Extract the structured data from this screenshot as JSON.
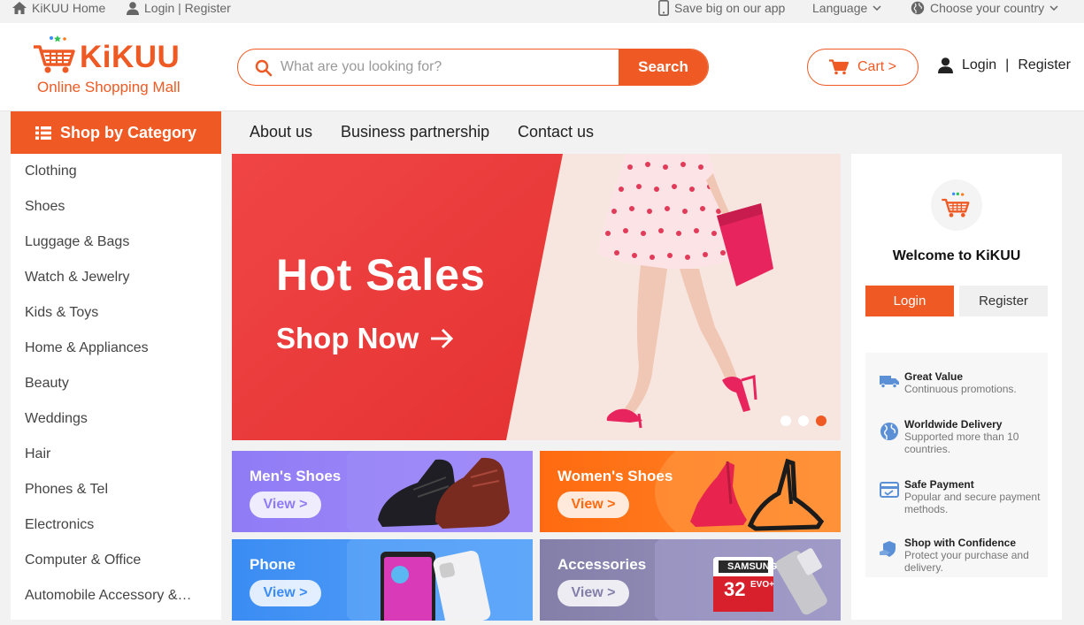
{
  "topbar": {
    "home_label": "KiKUU Home",
    "login_register": "Login | Register",
    "app_promo": "Save big on our app",
    "language": "Language",
    "country": "Choose your country"
  },
  "header": {
    "logo_name": "KiKUU",
    "logo_tagline": "Online Shopping Mall",
    "search_placeholder": "What are you looking for?",
    "search_button": "Search",
    "cart_label": "Cart >",
    "login_label": "Login",
    "separator": "|",
    "register_label": "Register"
  },
  "sidebar": {
    "title": "Shop by Category",
    "items": [
      {
        "label": "Clothing"
      },
      {
        "label": "Shoes"
      },
      {
        "label": "Luggage & Bags"
      },
      {
        "label": "Watch & Jewelry"
      },
      {
        "label": "Kids & Toys"
      },
      {
        "label": "Home & Appliances"
      },
      {
        "label": "Beauty"
      },
      {
        "label": "Weddings"
      },
      {
        "label": "Hair"
      },
      {
        "label": "Phones & Tel"
      },
      {
        "label": "Electronics"
      },
      {
        "label": "Computer & Office"
      },
      {
        "label": "Automobile Accessory &…"
      }
    ]
  },
  "nav": {
    "items": [
      {
        "label": "About us"
      },
      {
        "label": "Business partnership"
      },
      {
        "label": "Contact us"
      }
    ]
  },
  "banner": {
    "title": "Hot Sales",
    "cta": "Shop Now",
    "slide_count": 3,
    "active_slide": 3
  },
  "tiles": [
    {
      "title": "Men's Shoes",
      "button": "View >",
      "color": "#8b7cf6"
    },
    {
      "title": "Women's Shoes",
      "button": "View >",
      "color": "#ff7a1a"
    },
    {
      "title": "Phone",
      "button": "View >",
      "color": "#4a9af5"
    },
    {
      "title": "Accessories",
      "button": "View >",
      "color": "#8a86b0"
    }
  ],
  "right_panel": {
    "welcome": "Welcome to KiKUU",
    "login_button": "Login",
    "register_button": "Register",
    "features": [
      {
        "title": "Great Value",
        "desc": "Continuous promotions.",
        "icon": "truck-icon"
      },
      {
        "title": "Worldwide Delivery",
        "desc": "Supported more than 10 countries.",
        "icon": "globe-icon"
      },
      {
        "title": "Safe Payment",
        "desc": "Popular and secure payment methods.",
        "icon": "card-icon"
      },
      {
        "title": "Shop with Confidence",
        "desc": "Protect your purchase and delivery.",
        "icon": "shield-hand-icon"
      }
    ]
  },
  "colors": {
    "accent": "#ef5a24",
    "banner_red": "#f04545",
    "feature_icon": "#5b8fd6"
  }
}
